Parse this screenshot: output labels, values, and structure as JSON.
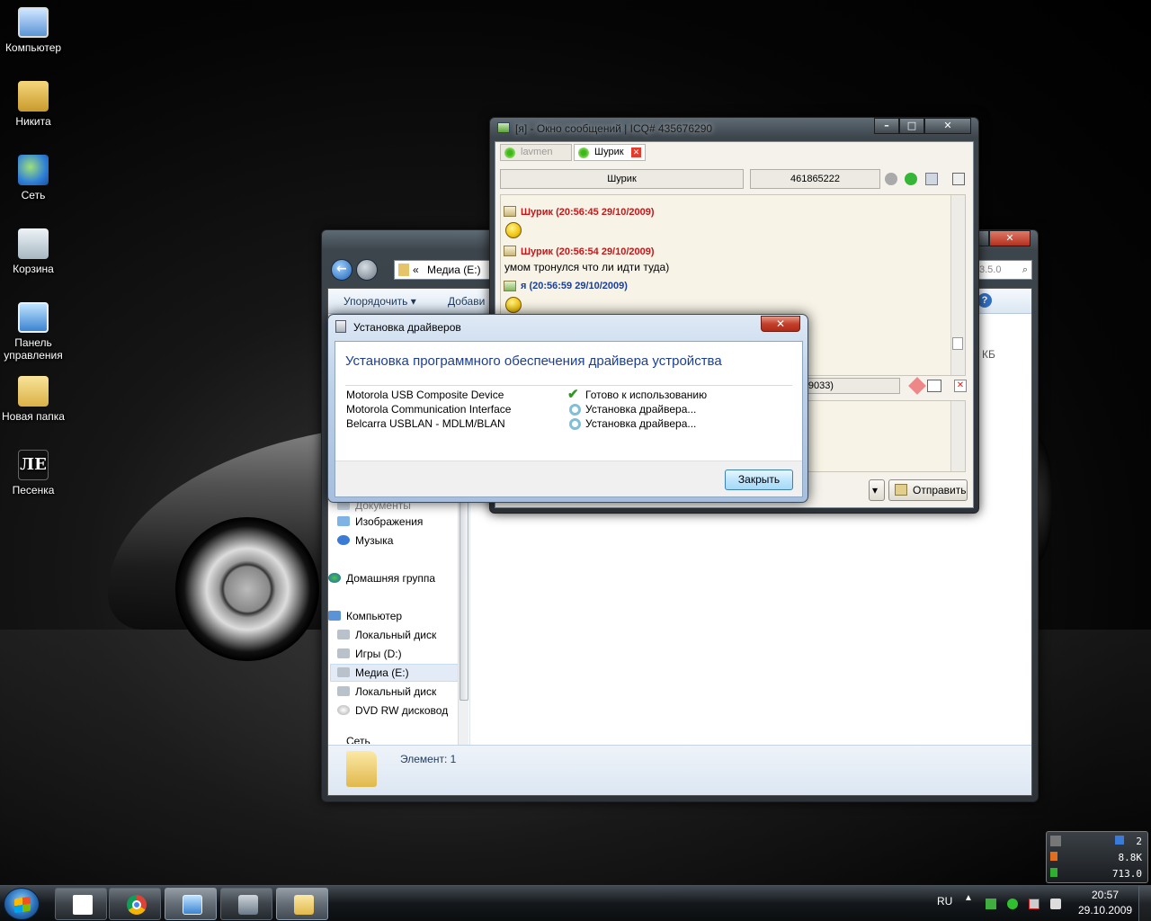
{
  "desktop": {
    "icons": [
      {
        "label": "Компьютер",
        "icon": "computer-icon"
      },
      {
        "label": "Никита",
        "icon": "user-folder-icon"
      },
      {
        "label": "Сеть",
        "icon": "network-icon"
      },
      {
        "label": "Корзина",
        "icon": "recycle-bin-icon"
      },
      {
        "label": "Панель управления",
        "icon": "control-panel-icon"
      },
      {
        "label": "Новая папка",
        "icon": "folder-icon"
      },
      {
        "label": "Песенка",
        "icon": "song-icon"
      }
    ],
    "song_glyph": "ЛЕ"
  },
  "explorer": {
    "address": "Медиа (E:)",
    "address_prefix": "«",
    "search_fragment": "3.5.0",
    "toolbar": {
      "organize": "Упорядочить ▾",
      "add": "Добави"
    },
    "size_fragment": "КБ",
    "nav_items": [
      {
        "label": "Документы",
        "icon": "documents-icon"
      },
      {
        "label": "Изображения",
        "icon": "pictures-icon"
      },
      {
        "label": "Музыка",
        "icon": "music-icon"
      },
      {
        "label": "Домашняя группа",
        "icon": "homegroup-icon"
      },
      {
        "label": "Компьютер",
        "icon": "computer-icon"
      },
      {
        "label": "Локальный диск",
        "icon": "drive-icon"
      },
      {
        "label": "Игры (D:)",
        "icon": "drive-icon"
      },
      {
        "label": "Медиа (E:)",
        "icon": "drive-icon",
        "selected": true
      },
      {
        "label": "Локальный диск",
        "icon": "drive-icon"
      },
      {
        "label": "DVD RW дисковод",
        "icon": "dvd-icon"
      },
      {
        "label": "Сеть",
        "icon": "network-icon"
      }
    ],
    "status": "Элемент: 1"
  },
  "icq": {
    "title": "[я] - Окно сообщений | ICQ# 435676290",
    "tabs": [
      {
        "label": "lavmen",
        "active": false
      },
      {
        "label": "Шурик",
        "active": true
      }
    ],
    "contact_name": "Шурик",
    "contact_uin": "461865222",
    "messages": [
      {
        "author": "Шурик (20:56:45 29/10/2009)",
        "from": "contact",
        "smiley": true,
        "text": ""
      },
      {
        "author": "Шурик (20:56:54 29/10/2009)",
        "from": "contact",
        "smiley": false,
        "text": "умом тронулся что ли идти туда)"
      },
      {
        "author": "я (20:56:59 29/10/2009)",
        "from": "me",
        "smiley": true,
        "text": ""
      }
    ],
    "encoding_fragment": "n (9033)",
    "send_label": "Отправить"
  },
  "dialog": {
    "title": "Установка драйверов",
    "heading": "Установка программного обеспечения драйвера устройства",
    "devices": [
      {
        "name": "Motorola USB Composite Device",
        "status": "Готово к использованию",
        "state": "ok"
      },
      {
        "name": "Motorola Communication Interface",
        "status": "Установка драйвера...",
        "state": "pending"
      },
      {
        "name": "Belcarra USBLAN - MDLM/BLAN",
        "status": "Установка драйвера...",
        "state": "pending"
      }
    ],
    "close_label": "Закрыть"
  },
  "meter": {
    "row1": "2",
    "row2": "8.8K",
    "row3": "713.0"
  },
  "taskbar": {
    "apps": [
      "explorer-blank-icon",
      "chrome-icon",
      "control-panel-icon",
      "device-manager-icon",
      "folder-explorer-icon"
    ],
    "lang": "RU",
    "time": "20:57",
    "date": "29.10.2009"
  }
}
